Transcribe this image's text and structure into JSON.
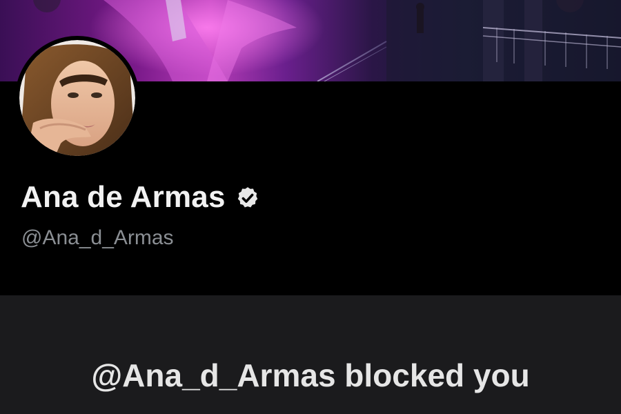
{
  "profile": {
    "display_name": "Ana de Armas",
    "handle": "@Ana_d_Armas",
    "verified_icon": "verified-badge-icon"
  },
  "blocked": {
    "message": "@Ana_d_Armas blocked you"
  },
  "colors": {
    "background": "#000000",
    "panel": "#1b1b1d",
    "name_text": "#f2f2f2",
    "handle_text": "#8b8f94",
    "banner_accent": "#b53bb6"
  }
}
